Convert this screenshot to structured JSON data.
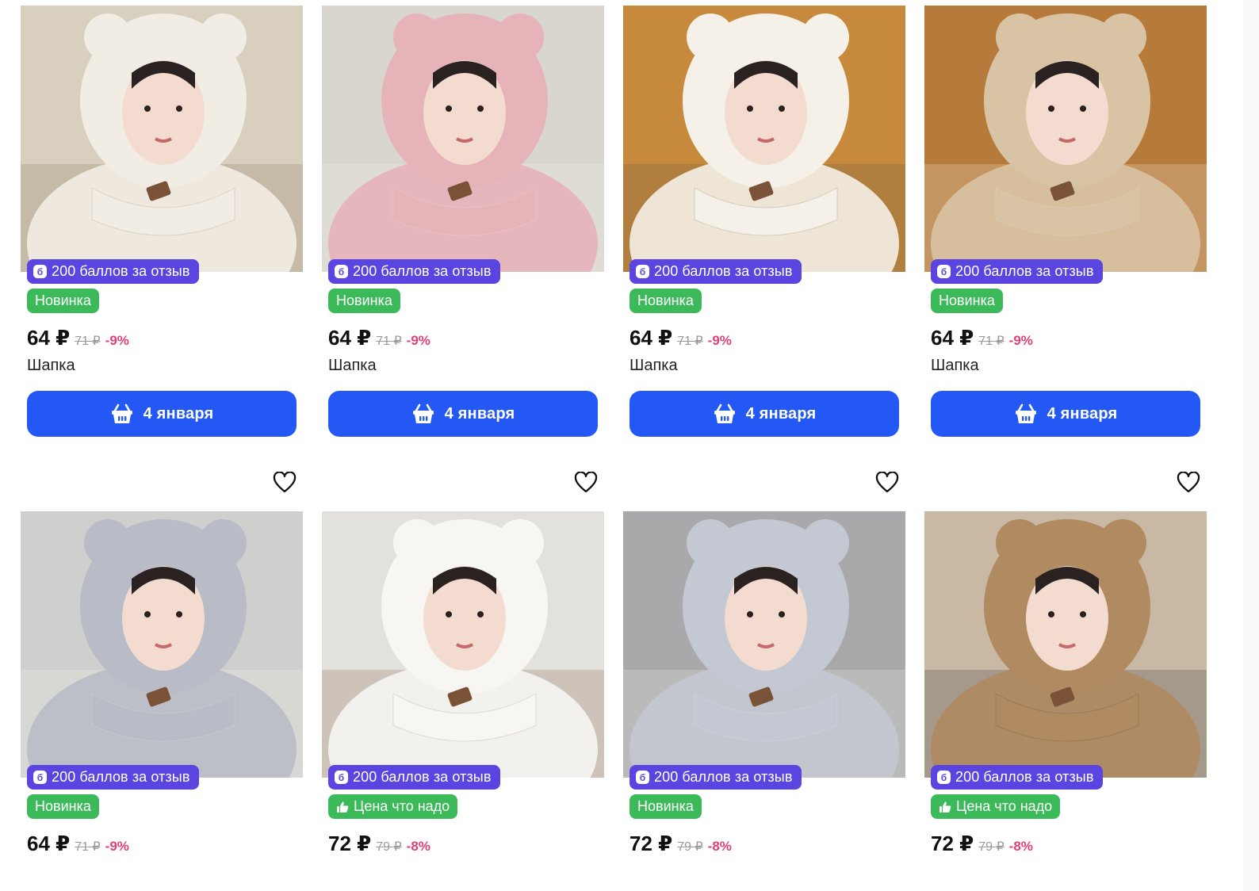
{
  "colors": {
    "points_badge": "#5a45e0",
    "new_badge": "#3cba5a",
    "cart_button": "#2458f5",
    "discount": "#e0407a",
    "old_price": "#9a9a9a"
  },
  "products": [
    {
      "photo_desc": "cream bear hood",
      "photo_colors": [
        "#d8cfbf",
        "#f2ede4",
        "#8a7a60"
      ],
      "points_label": "200 баллов за отзыв",
      "tag_type": "new",
      "tag_label": "Новинка",
      "price": "64 ₽",
      "old_price": "71 ₽",
      "discount": "-9%",
      "title": "Шапка",
      "delivery": "4 января"
    },
    {
      "photo_desc": "pink bear hood",
      "photo_colors": [
        "#d9d5cf",
        "#e6b3b9",
        "#f3efe8"
      ],
      "points_label": "200 баллов за отзыв",
      "tag_type": "new",
      "tag_label": "Новинка",
      "price": "64 ₽",
      "old_price": "71 ₽",
      "discount": "-9%",
      "title": "Шапка",
      "delivery": "4 января"
    },
    {
      "photo_desc": "white bear hood autumn",
      "photo_colors": [
        "#c78a3d",
        "#f5f1e8",
        "#6b5a44"
      ],
      "points_label": "200 баллов за отзыв",
      "tag_type": "new",
      "tag_label": "Новинка",
      "price": "64 ₽",
      "old_price": "71 ₽",
      "discount": "-9%",
      "title": "Шапка",
      "delivery": "4 января"
    },
    {
      "photo_desc": "beige bear hood autumn",
      "photo_colors": [
        "#b67a3a",
        "#d9c3a5",
        "#efe6da"
      ],
      "points_label": "200 баллов за отзыв",
      "tag_type": "new",
      "tag_label": "Новинка",
      "price": "64 ₽",
      "old_price": "71 ₽",
      "discount": "-9%",
      "title": "Шапка",
      "delivery": "4 января"
    },
    {
      "photo_desc": "grey bear hood",
      "photo_colors": [
        "#cfcfcd",
        "#b9bcc6",
        "#f1eee8"
      ],
      "points_label": "200 баллов за отзыв",
      "tag_type": "new",
      "tag_label": "Новинка",
      "price": "64 ₽",
      "old_price": "71 ₽",
      "discount": "-9%",
      "title": "",
      "delivery": ""
    },
    {
      "photo_desc": "white knit bear hood",
      "photo_colors": [
        "#e3e1dd",
        "#f7f6f3",
        "#8a6a4a"
      ],
      "points_label": "200 баллов за отзыв",
      "tag_type": "price",
      "tag_label": "Цена что надо",
      "price": "72 ₽",
      "old_price": "79 ₽",
      "discount": "-8%",
      "title": "",
      "delivery": ""
    },
    {
      "photo_desc": "grey knit bear hood",
      "photo_colors": [
        "#a9a9ab",
        "#c4c8d2",
        "#f0eeea"
      ],
      "points_label": "200 баллов за отзыв",
      "tag_type": "new",
      "tag_label": "Новинка",
      "price": "72 ₽",
      "old_price": "79 ₽",
      "discount": "-8%",
      "title": "",
      "delivery": ""
    },
    {
      "photo_desc": "brown knit bear hood",
      "photo_colors": [
        "#c9b9a4",
        "#b08a60",
        "#3a3a40"
      ],
      "points_label": "200 баллов за отзыв",
      "tag_type": "price",
      "tag_label": "Цена что надо",
      "price": "72 ₽",
      "old_price": "79 ₽",
      "discount": "-8%",
      "title": "",
      "delivery": ""
    }
  ],
  "icons": {
    "points": "б",
    "heart": "heart-outline-icon",
    "cart": "basket-icon",
    "thumb": "thumbs-up-icon"
  }
}
